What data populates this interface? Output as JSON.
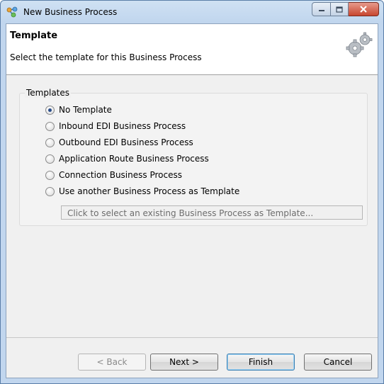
{
  "window": {
    "title": "New Business Process",
    "icon": "process-icon"
  },
  "header": {
    "title": "Template",
    "description": "Select the template for this Business Process",
    "icon": "gears-icon"
  },
  "templates": {
    "legend": "Templates",
    "selected_index": 0,
    "options": [
      "No Template",
      "Inbound EDI Business Process",
      "Outbound EDI Business Process",
      "Application Route Business Process",
      "Connection Business Process",
      "Use another Business Process as Template"
    ],
    "picker_placeholder": "Click to select an existing Business Process as Template..."
  },
  "buttons": {
    "back": "< Back",
    "next": "Next >",
    "finish": "Finish",
    "cancel": "Cancel"
  },
  "colors": {
    "title_bar": "#c1d6ee",
    "close_button": "#c7462f",
    "radio_selected": "#2a4d8a"
  }
}
